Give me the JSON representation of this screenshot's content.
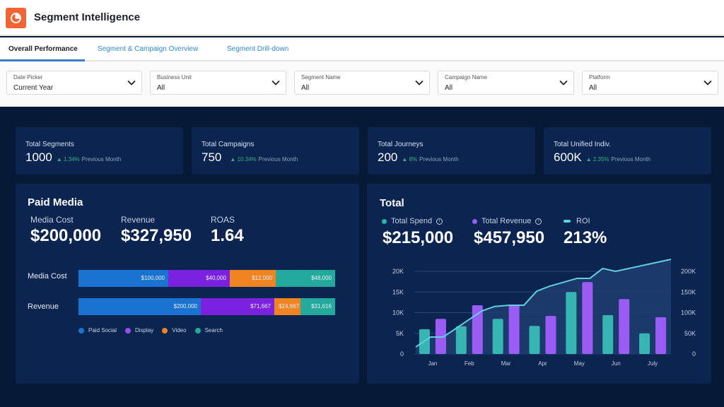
{
  "app": {
    "title": "Segment Intelligence",
    "logo_icon": "pie-chart-icon"
  },
  "tabs": [
    {
      "label": "Overall Performance",
      "active": true
    },
    {
      "label": "Segment & Campaign Overview",
      "active": false
    },
    {
      "label": "Segment Drill-down",
      "active": false
    }
  ],
  "filters": [
    {
      "label": "Date Picker",
      "value": "Current Year"
    },
    {
      "label": "Business Unit",
      "value": "All"
    },
    {
      "label": "Segment Name",
      "value": "All"
    },
    {
      "label": "Campaign Name",
      "value": "All"
    },
    {
      "label": "Platform",
      "value": "All"
    }
  ],
  "kpis": [
    {
      "label": "Total Segments",
      "value": "1000",
      "delta": "▲ 1.34%",
      "delta_text": "Previous Month"
    },
    {
      "label": "Total Campaigns",
      "value": "750",
      "delta": "▲ 10.34%",
      "delta_text": "Previous Month"
    },
    {
      "label": "Total Journeys",
      "value": "200",
      "delta": "▲ 8%",
      "delta_text": "Previous Month"
    },
    {
      "label": "Total Unified Indiv.",
      "value": "600K",
      "delta": "▲ 2.35%",
      "delta_text": "Previous Month"
    }
  ],
  "paid_media": {
    "title": "Paid Media",
    "metrics": [
      {
        "label": "Media Cost",
        "value": "$200,000"
      },
      {
        "label": "Revenue",
        "value": "$327,950"
      },
      {
        "label": "ROAS",
        "value": "1.64"
      }
    ],
    "legend": [
      {
        "label": "Paid Social",
        "color": "#1a73d1"
      },
      {
        "label": "Display",
        "color": "#7a22e0"
      },
      {
        "label": "Video",
        "color": "#ef8421"
      },
      {
        "label": "Search",
        "color": "#24a99d"
      }
    ],
    "bars": [
      {
        "label": "Media Cost",
        "segments": [
          {
            "name": "Paid Social",
            "value": 100000,
            "text": "$100,000"
          },
          {
            "name": "Display",
            "value": 40000,
            "text": "$40,000"
          },
          {
            "name": "Video",
            "value": 12000,
            "text": "$12,000"
          },
          {
            "name": "Search",
            "value": 48000,
            "text": "$48,000"
          }
        ]
      },
      {
        "label": "Revenue",
        "segments": [
          {
            "name": "Paid Social",
            "value": 200000,
            "text": "$200,000"
          },
          {
            "name": "Display",
            "value": 71667,
            "text": "$71,667"
          },
          {
            "name": "Video",
            "value": 24667,
            "text": "$24,667"
          },
          {
            "name": "Search",
            "value": 31616,
            "text": "$31,616"
          }
        ]
      }
    ]
  },
  "total": {
    "title": "Total",
    "metrics": [
      {
        "label": "Total Spend",
        "value": "$215,000",
        "color": "#2bb5a8",
        "marker": "dot",
        "info": true
      },
      {
        "label": "Total Revenue",
        "value": "$457,950",
        "color": "#9a5cf5",
        "marker": "dot",
        "info": true
      },
      {
        "label": "ROI",
        "value": "213%",
        "color": "#5ed0e0",
        "marker": "line",
        "info": false
      }
    ]
  },
  "chart_data": {
    "type": "bar",
    "title": "Total",
    "categories": [
      "Jan",
      "Feb",
      "Mar",
      "Apr",
      "May",
      "Jun",
      "July"
    ],
    "series": [
      {
        "name": "Total Spend",
        "type": "bar",
        "axis": "left",
        "color": "#36b5b3",
        "values": [
          6000,
          6700,
          8500,
          6800,
          15000,
          9400,
          5000
        ]
      },
      {
        "name": "Total Revenue",
        "type": "bar",
        "axis": "left",
        "color": "#9b5cf6",
        "values": [
          8500,
          11800,
          11800,
          9200,
          17400,
          13300,
          8900
        ]
      },
      {
        "name": "ROI",
        "type": "area-line",
        "axis": "right",
        "color": "#5ed0e0",
        "x": [
          0,
          0.4,
          0.75,
          1.2,
          1.8,
          2.15,
          2.55,
          2.95,
          3.3,
          3.65,
          4.05,
          4.4,
          4.75,
          5.1,
          5.45,
          5.85
        ],
        "values": [
          17000,
          41000,
          41000,
          68000,
          104000,
          115000,
          118000,
          118000,
          152000,
          164000,
          174000,
          183000,
          183000,
          207000,
          200000,
          229000
        ]
      }
    ],
    "left_axis": {
      "ticks": [
        "0",
        "5K",
        "10K",
        "15K",
        "20K"
      ],
      "range": [
        0,
        20000
      ]
    },
    "right_axis": {
      "ticks": [
        "0",
        "50K",
        "100K",
        "150K",
        "200K"
      ],
      "range": [
        0,
        200000
      ]
    },
    "grid": true,
    "legend": "top-left"
  }
}
